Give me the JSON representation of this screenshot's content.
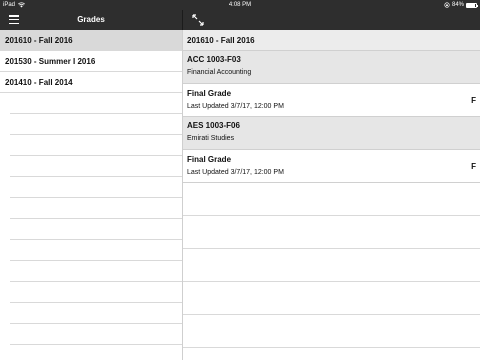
{
  "status_bar": {
    "device": "iPad",
    "time": "4:08 PM",
    "battery_percent": "84%",
    "battery_level": 0.84
  },
  "nav": {
    "title": "Grades"
  },
  "terms": [
    {
      "label": "201610 - Fall 2016",
      "selected": true
    },
    {
      "label": "201530 - Summer I 2016",
      "selected": false
    },
    {
      "label": "201410 - Fall 2014",
      "selected": false
    }
  ],
  "detail": {
    "term_header": "201610 - Fall 2016",
    "courses": [
      {
        "code": "ACC 1003-F03",
        "name": "Financial Accounting",
        "grade_title": "Final Grade",
        "last_updated": "Last Updated 3/7/17, 12:00 PM",
        "grade": "F"
      },
      {
        "code": "AES 1003-F06",
        "name": "Emirati Studies",
        "grade_title": "Final Grade",
        "last_updated": "Last Updated 3/7/17, 12:00 PM",
        "grade": "F"
      }
    ]
  },
  "colors": {
    "bar": "#2e2e2e",
    "selected_row": "#d9d9d9",
    "course_header": "#e6e6e6"
  }
}
